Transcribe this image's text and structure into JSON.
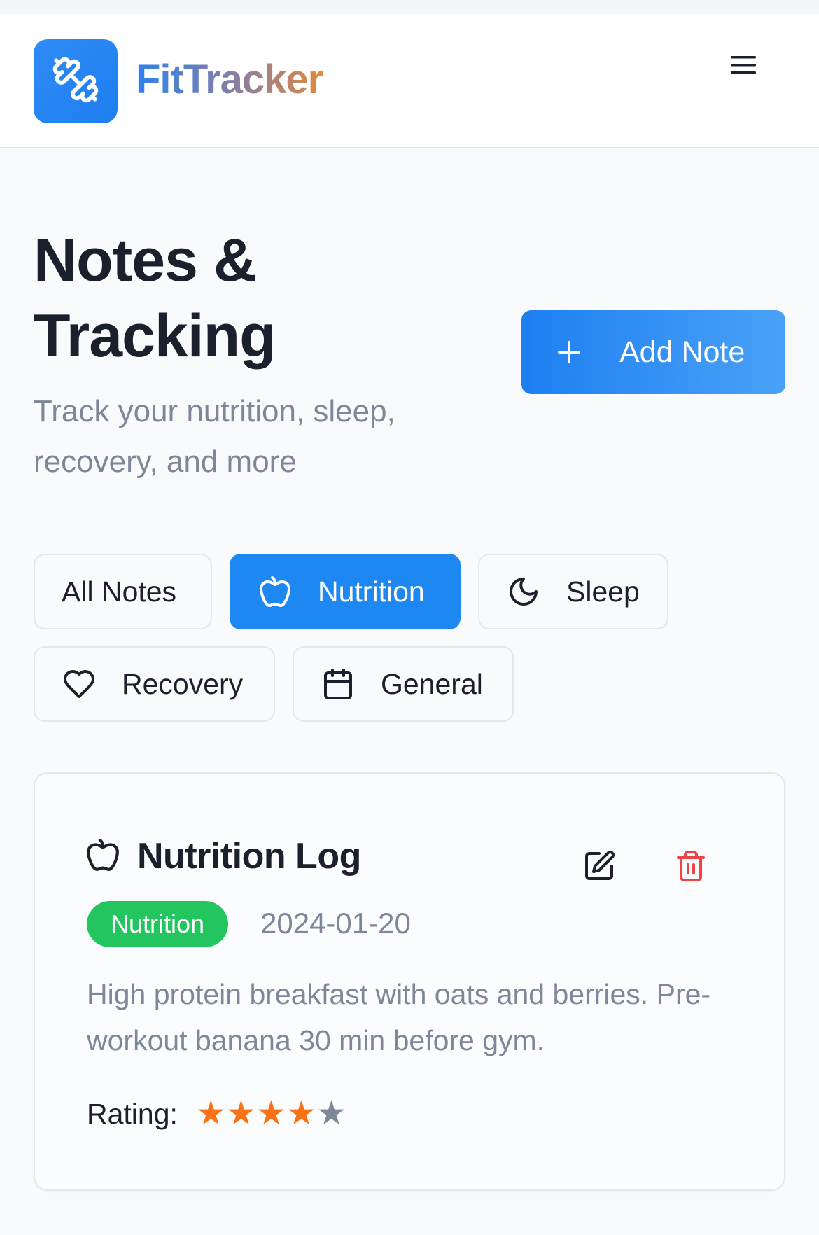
{
  "app": {
    "name": "FitTracker"
  },
  "header": {
    "menu_icon": "hamburger-menu-icon",
    "logo_icon": "dumbbell-icon"
  },
  "page": {
    "title": "Notes & Tracking",
    "subtitle": "Track your nutrition, sleep, recovery, and more",
    "add_button_label": "Add Note"
  },
  "filters": [
    {
      "label": "All Notes",
      "icon": null,
      "active": false
    },
    {
      "label": "Nutrition",
      "icon": "apple-icon",
      "active": true
    },
    {
      "label": "Sleep",
      "icon": "moon-icon",
      "active": false
    },
    {
      "label": "Recovery",
      "icon": "heart-icon",
      "active": false
    },
    {
      "label": "General",
      "icon": "calendar-icon",
      "active": false
    }
  ],
  "notes": [
    {
      "title": "Nutrition Log",
      "icon": "apple-icon",
      "category": "Nutrition",
      "date": "2024-01-20",
      "body": "High protein breakfast with oats and berries. Pre-workout banana 30 min before gym.",
      "rating_label": "Rating:",
      "rating": 4,
      "rating_max": 5
    }
  ],
  "colors": {
    "primary": "#1e88f2",
    "badge_nutrition": "#22c55e",
    "star_on": "#f97316",
    "star_off": "#7c8798",
    "delete": "#ef4444"
  }
}
